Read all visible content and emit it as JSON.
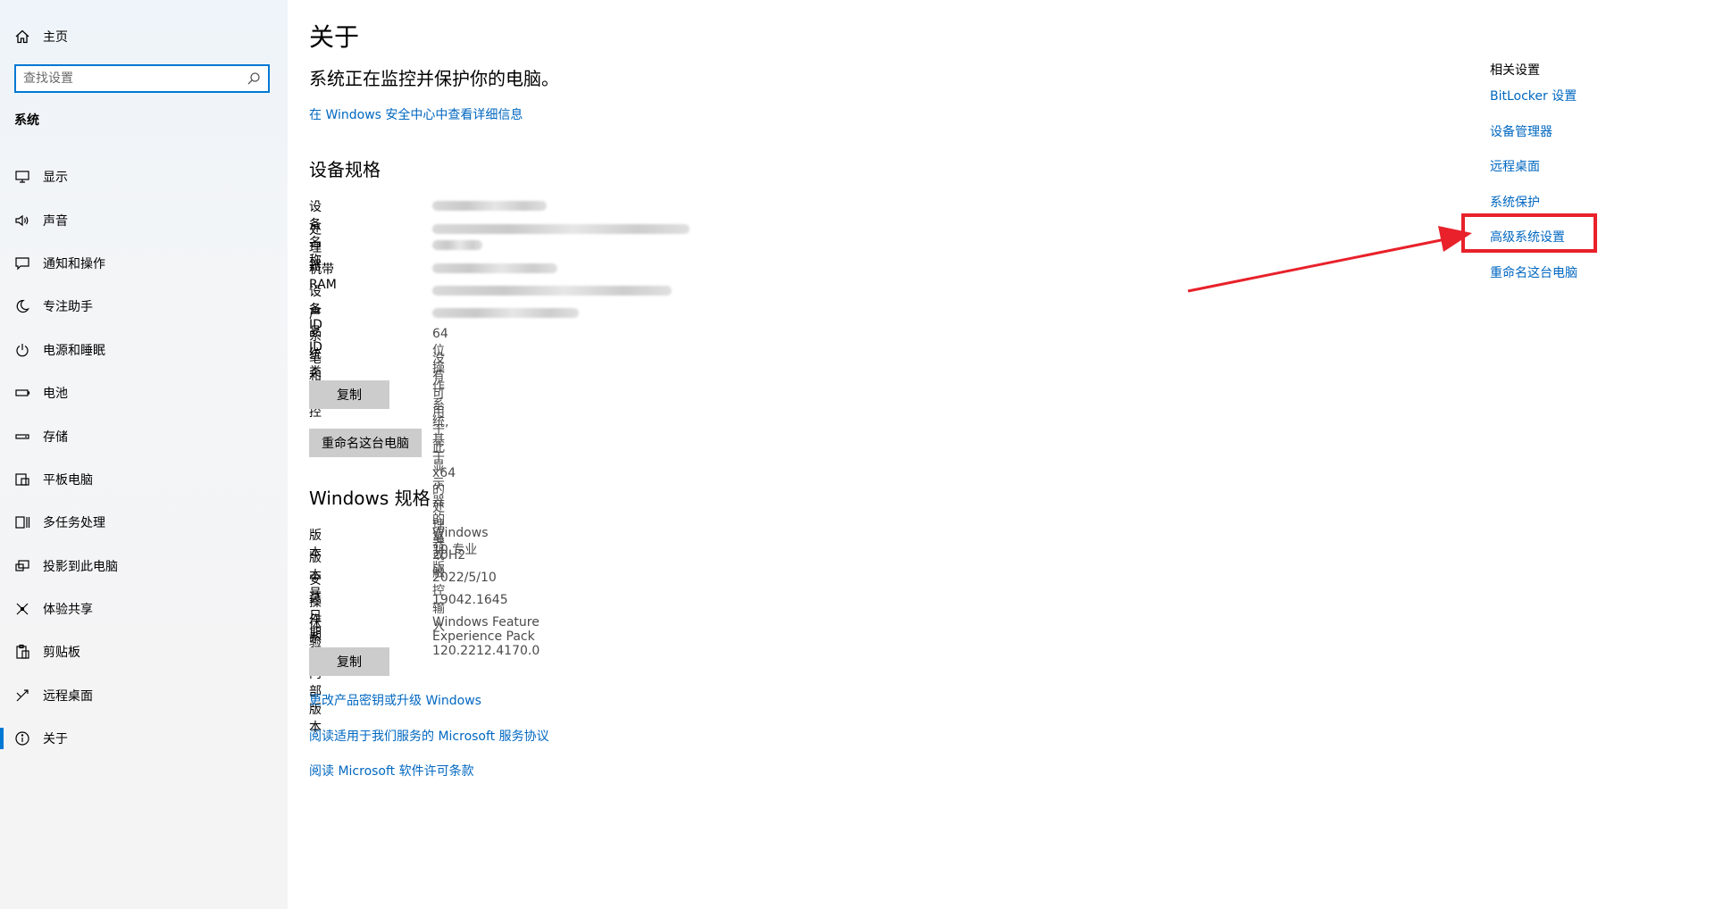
{
  "sidebar": {
    "home_label": "主页",
    "search_placeholder": "查找设置",
    "section_title": "系统",
    "items": [
      {
        "label": "显示",
        "icon": "monitor-icon"
      },
      {
        "label": "声音",
        "icon": "speaker-icon"
      },
      {
        "label": "通知和操作",
        "icon": "notification-icon"
      },
      {
        "label": "专注助手",
        "icon": "moon-icon"
      },
      {
        "label": "电源和睡眠",
        "icon": "power-icon"
      },
      {
        "label": "电池",
        "icon": "battery-icon"
      },
      {
        "label": "存储",
        "icon": "storage-icon"
      },
      {
        "label": "平板电脑",
        "icon": "tablet-icon"
      },
      {
        "label": "多任务处理",
        "icon": "multitask-icon"
      },
      {
        "label": "投影到此电脑",
        "icon": "project-icon"
      },
      {
        "label": "体验共享",
        "icon": "share-icon"
      },
      {
        "label": "剪贴板",
        "icon": "clipboard-icon"
      },
      {
        "label": "远程桌面",
        "icon": "remote-icon"
      },
      {
        "label": "关于",
        "icon": "info-icon",
        "active": true
      }
    ]
  },
  "main": {
    "title": "关于",
    "protect_text": "系统正在监控并保护你的电脑。",
    "security_link": "在 Windows 安全中心中查看详细信息",
    "device_specs": {
      "heading": "设备规格",
      "rows": [
        {
          "key": "设备名称",
          "value": "",
          "blurred": true
        },
        {
          "key": "处理器",
          "value": "",
          "blurred": true
        },
        {
          "key": "机带 RAM",
          "value": "",
          "blurred": true
        },
        {
          "key": "设备 ID",
          "value": "",
          "blurred": true
        },
        {
          "key": "产品 ID",
          "value": "",
          "blurred": true
        },
        {
          "key": "系统类型",
          "value": "64 位操作系统, 基于 x64 的处理器"
        },
        {
          "key": "笔和触控",
          "value": "没有可用于此显示器的笔或触控输入"
        }
      ],
      "copy_button": "复制",
      "rename_button": "重命名这台电脑"
    },
    "windows_specs": {
      "heading": "Windows 规格",
      "rows": [
        {
          "key": "版本",
          "value": "Windows 10 专业版"
        },
        {
          "key": "版本号",
          "value": "20H2"
        },
        {
          "key": "安装日期",
          "value": "2022/5/10"
        },
        {
          "key": "操作系统内部版本",
          "value": "19042.1645"
        },
        {
          "key": "体验",
          "value": "Windows Feature Experience Pack 120.2212.4170.0"
        }
      ],
      "copy_button": "复制"
    },
    "links": [
      "更改产品密钥或升级 Windows",
      "阅读适用于我们服务的 Microsoft 服务协议",
      "阅读 Microsoft 软件许可条款"
    ]
  },
  "related": {
    "title": "相关设置",
    "links": [
      "BitLocker 设置",
      "设备管理器",
      "远程桌面",
      "系统保护",
      "高级系统设置",
      "重命名这台电脑"
    ]
  },
  "annotation": {
    "color": "#e8212a"
  }
}
